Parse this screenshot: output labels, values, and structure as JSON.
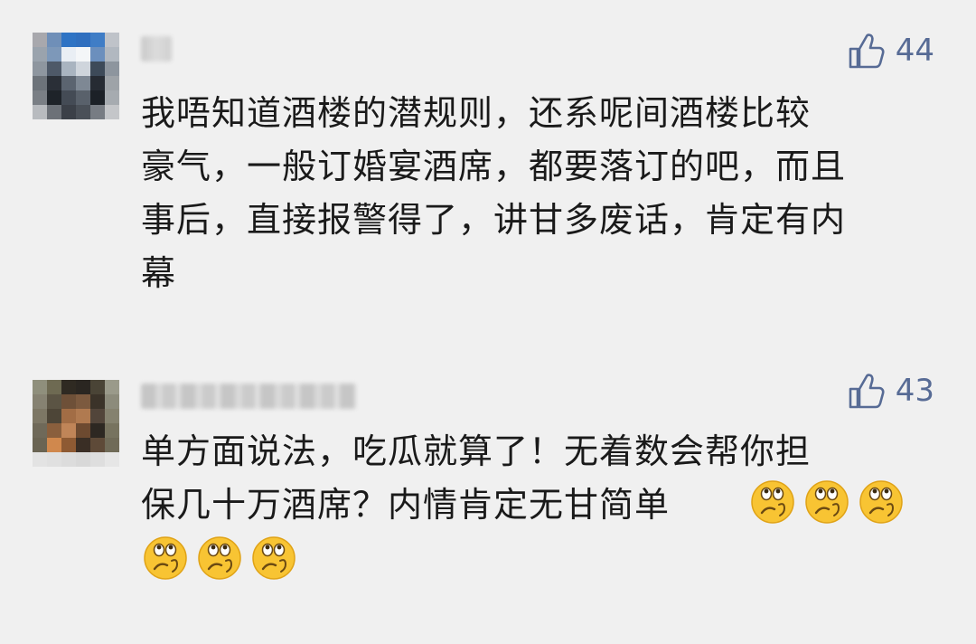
{
  "comments": [
    {
      "author_name": "",
      "likes": "44",
      "text": "我唔知道酒楼的潜规则，还系呢间酒楼比较\n豪气，一般订婚宴酒席，都要落订的吧，而且\n事后，直接报警得了，讲甘多废话，肯定有内\n幕",
      "emoji": []
    },
    {
      "author_name": "",
      "likes": "43",
      "text": "单方面说法，吃瓜就算了！无着数会帮你担\n保几十万酒席？内情肯定无甘简单",
      "emoji": [
        "thinking-face-emoji",
        "thinking-face-emoji",
        "thinking-face-emoji",
        "thinking-face-emoji",
        "thinking-face-emoji",
        "thinking-face-emoji"
      ]
    }
  ],
  "colors": {
    "background": "#f0f0f0",
    "like_accent": "#576b95",
    "text": "#1a1a1a"
  }
}
